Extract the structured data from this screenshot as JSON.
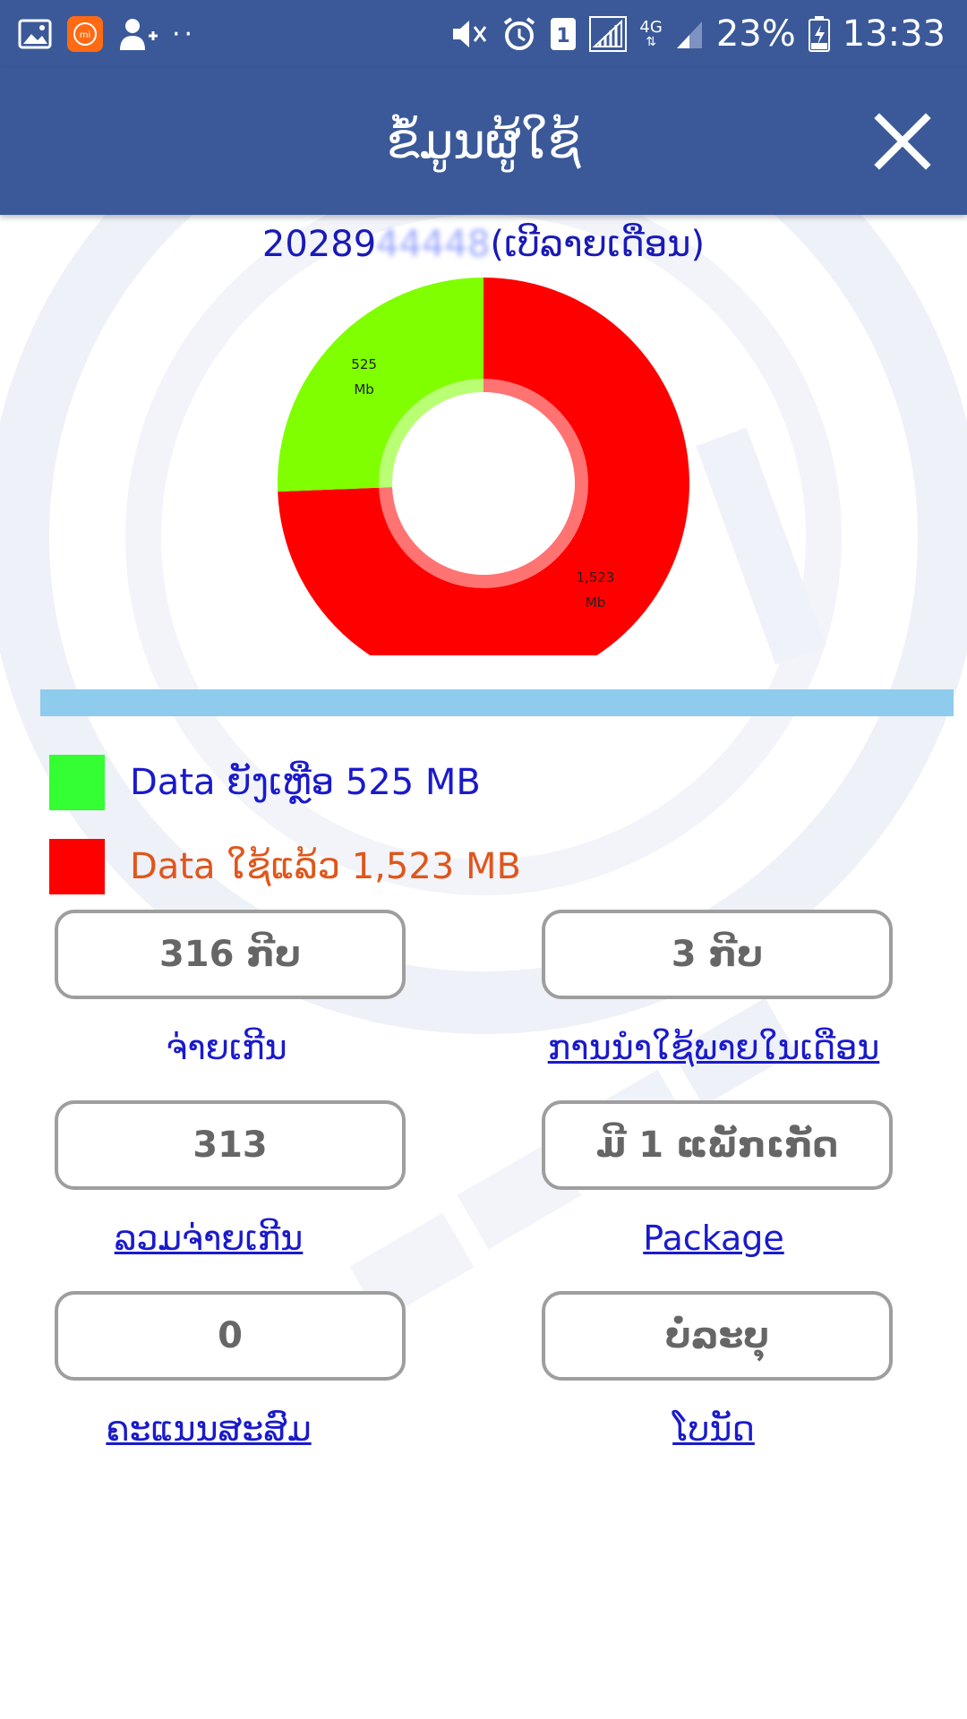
{
  "status_bar": {
    "battery": "23%",
    "time": "13:33",
    "network": "4G",
    "sim_slot": "1",
    "icons": [
      "gallery-icon",
      "mi-icon",
      "add-contact-icon",
      "more-dots-icon",
      "mute-vibrate-icon",
      "alarm-icon",
      "sim-1-icon",
      "signal-icon",
      "network-4g-icon",
      "signal-2-icon",
      "battery-icon"
    ]
  },
  "header": {
    "title": "ຂໍ້ມູນຜູ້ໃຊ້",
    "close_icon": "close-icon"
  },
  "account": {
    "number_prefix": "20289",
    "number_masked": "44448",
    "plan": "(ເບີລາຍເດືອນ)"
  },
  "chart_data": {
    "type": "pie",
    "values": [
      525,
      1523
    ],
    "unit": "Mb",
    "slice_labels": [
      {
        "value": "525",
        "unit": "Mb"
      },
      {
        "value": "1,523",
        "unit": "Mb"
      }
    ],
    "colors": [
      "#80ff00",
      "#ff0000"
    ],
    "donut": true
  },
  "legend": [
    {
      "text": "Data ຍັງເຫຼືອ 525 MB",
      "color": "#33ff33",
      "text_color": "#1a1acc"
    },
    {
      "text": "Data ໃຊ້ແລ້ວ 1,523 MB",
      "color": "#ff0000",
      "text_color": "#e0561c"
    }
  ],
  "stats": [
    {
      "value": "316 ກີບ",
      "label": "ຈ່າຍເກີນ",
      "link": false
    },
    {
      "value": "3 ກີບ",
      "label": "ການນຳໃຊ້ພາຍໃນເດືອນ",
      "link": true
    },
    {
      "value": "313",
      "label": "ລວມຈ່າຍເກີນ",
      "link": true
    },
    {
      "value": "ມີ 1 ແພັກເກັດ",
      "label": "Package",
      "link": true
    },
    {
      "value": "0",
      "label": "ຄະແນນສະສົມ",
      "link": true
    },
    {
      "value": "ບໍ່ລະບຸ",
      "label": "ໂບນັດ",
      "link": true
    }
  ],
  "colors": {
    "header_bg": "#3b5998",
    "accent_bar": "#8ecbec",
    "label_blue": "#1a1acc"
  }
}
